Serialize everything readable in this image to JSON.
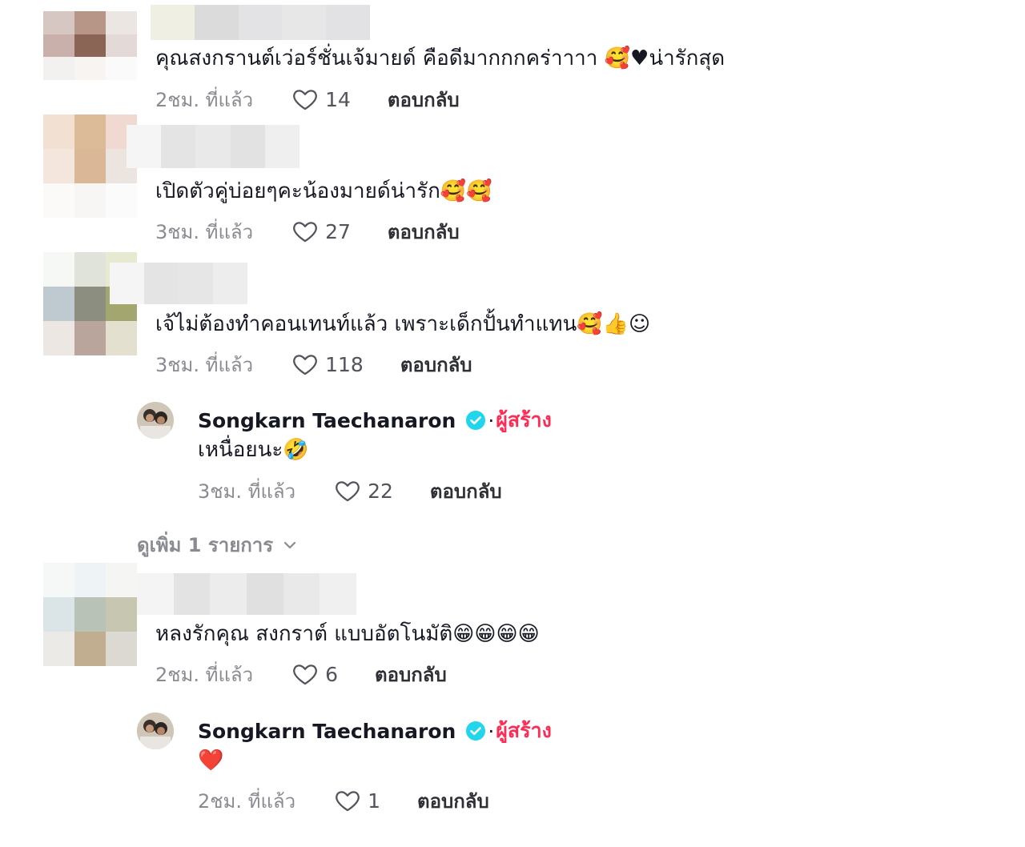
{
  "comments": [
    {
      "text": "คุณสงกรานต์เว่อร์ชั่นเจ้มายด์ คือดีมากกกคร่าาาา 🥰♥น่ารักสุด",
      "time": "2ชม. ที่แล้ว",
      "likes": "14",
      "reply_label": "ตอบกลับ",
      "avatar_colors": [
        "#d6c7c2",
        "#b89687",
        "#ece6e3",
        "#c9b0aa",
        "#8a6555",
        "#e3dad7",
        "#f3f1f0",
        "#f7f4f2",
        "#fafafa"
      ],
      "name_blur_colors": [
        "#f0efe4",
        "#dcdbdc",
        "#e3e2e4",
        "#e8e7e8",
        "#e2e1e3"
      ]
    },
    {
      "text": "เปิดตัวคู่บ่อยๆคะน้องมายด์น่ารัก🥰🥰",
      "time": "3ชม. ที่แล้ว",
      "likes": "27",
      "reply_label": "ตอบกลับ",
      "avatar_colors": [
        "#f2e0d3",
        "#dcbb98",
        "#f0d9d0",
        "#f4e6dc",
        "#d9b797",
        "#ece5df",
        "#fbfaf9",
        "#f8f6f4",
        "#fbfbfb"
      ],
      "name_blur_colors": [
        "#f5f5f5",
        "#e4e4e5",
        "#e9e9ea",
        "#e2e2e3",
        "#efeff0"
      ]
    },
    {
      "text": "เจ้ไม่ต้องทำคอนเทนท์แล้ว เพราะเด็กปั้นทำแทน🥰👍☺",
      "time": "3ชม. ที่แล้ว",
      "likes": "118",
      "reply_label": "ตอบกลับ",
      "avatar_colors": [
        "#f6f8f6",
        "#dfe3da",
        "#e7ead0",
        "#bfcad0",
        "#8c8e7f",
        "#a3a76f",
        "#ede7e4",
        "#b9a59b",
        "#e4e0cf"
      ],
      "name_blur_colors": [
        "#f5f5f5",
        "#e4e4e4",
        "#e6e6e6",
        "#ededed"
      ]
    },
    {
      "text": "หลงรักคุณ สงกราต์ แบบอัตโนมัติ😁😁😁😁",
      "time": "2ชม. ที่แล้ว",
      "likes": "6",
      "reply_label": "ตอบกลับ",
      "avatar_colors": [
        "#f6f8f8",
        "#eef3f6",
        "#f5f6f4",
        "#dbe4e6",
        "#b8c2b6",
        "#c7c6b0",
        "#eceae6",
        "#c1ad90",
        "#dcd8d2"
      ],
      "name_blur_colors": [
        "#f4f4f4",
        "#e3e3e4",
        "#ececec",
        "#e0e0e1",
        "#e9e9ea",
        "#f0f0f0"
      ]
    }
  ],
  "replies": [
    {
      "author": "Songkarn Taechanaron",
      "dot": "·",
      "creator_label": "ผู้สร้าง",
      "text": "เหนื่อยนะ🤣",
      "time": "3ชม. ที่แล้ว",
      "likes": "22",
      "reply_label": "ตอบกลับ"
    },
    {
      "author": "Songkarn Taechanaron",
      "dot": "·",
      "creator_label": "ผู้สร้าง",
      "text": "❤️",
      "time": "2ชม. ที่แล้ว",
      "likes": "1",
      "reply_label": "ตอบกลับ"
    }
  ],
  "view_more": {
    "label": "ดูเพิ่ม 1 รายการ"
  },
  "colors": {
    "accent": "#fe2c55",
    "verified": "#20d5ec",
    "muted": "#8a8b91"
  },
  "icons": {
    "like": "heart-outline-icon",
    "verified": "verified-badge-icon",
    "chevron": "chevron-down-icon"
  }
}
